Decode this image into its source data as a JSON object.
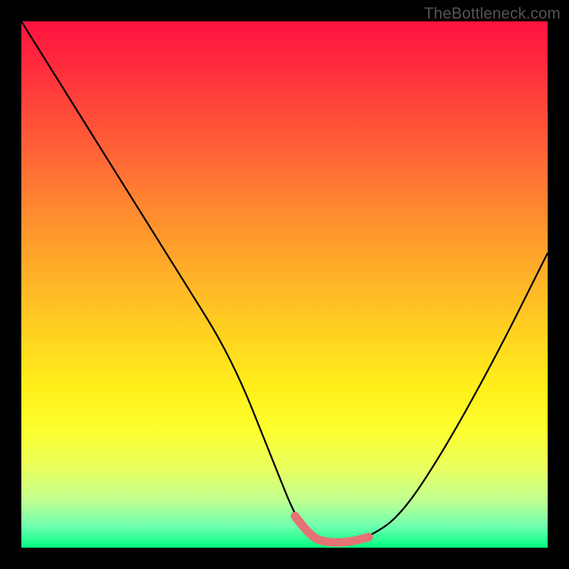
{
  "watermark": "TheBottleneck.com",
  "chart_data": {
    "type": "line",
    "title": "",
    "xlabel": "",
    "ylabel": "",
    "xlim": [
      0,
      100
    ],
    "ylim": [
      0,
      100
    ],
    "grid": false,
    "legend": false,
    "series": [
      {
        "name": "bottleneck-curve",
        "x": [
          0,
          10,
          20,
          30,
          40,
          48,
          52,
          55,
          58,
          62,
          66,
          72,
          80,
          90,
          100
        ],
        "y": [
          100,
          84,
          68,
          52,
          36,
          16,
          6,
          2,
          1,
          1,
          2,
          6,
          18,
          36,
          56
        ]
      }
    ],
    "highlight": {
      "name": "highlight-segment",
      "color": "#e57373",
      "x": [
        52,
        55,
        58,
        62,
        66
      ],
      "y": [
        6,
        2,
        1,
        1,
        2
      ]
    },
    "background_gradient": {
      "stops": [
        {
          "pos": 0,
          "color": "#ff133f"
        },
        {
          "pos": 36,
          "color": "#ff8a30"
        },
        {
          "pos": 70,
          "color": "#fff01a"
        },
        {
          "pos": 100,
          "color": "#00ff7f"
        }
      ]
    }
  }
}
